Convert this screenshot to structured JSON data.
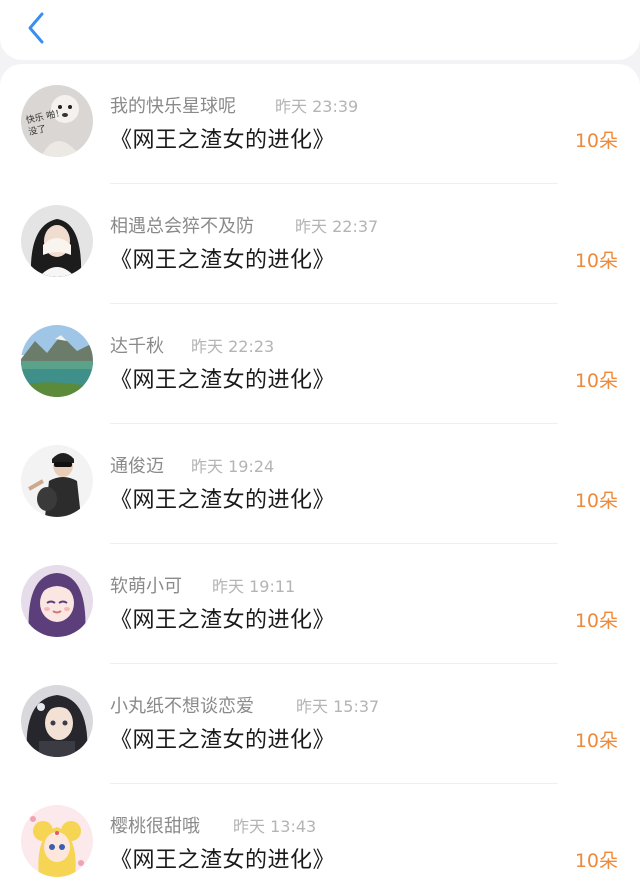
{
  "header": {
    "back_icon": "chevron-left-icon",
    "accent": "#3a8ff0"
  },
  "colors": {
    "amount": "#ee8a3a",
    "name": "#8a8a8a",
    "time": "#b4b4b4"
  },
  "gifts": [
    {
      "user": "我的快乐星球呢",
      "time": "昨天 23:39",
      "title": "《网王之渣女的进化》",
      "amount": "10朵",
      "avatar_caption": "快乐 啪！没了"
    },
    {
      "user": "相遇总会猝不及防",
      "time": "昨天 22:37",
      "title": "《网王之渣女的进化》",
      "amount": "10朵"
    },
    {
      "user": "达千秋",
      "time": "昨天 22:23",
      "title": "《网王之渣女的进化》",
      "amount": "10朵"
    },
    {
      "user": "通俊迈",
      "time": "昨天 19:24",
      "title": "《网王之渣女的进化》",
      "amount": "10朵"
    },
    {
      "user": "软萌小可",
      "time": "昨天 19:11",
      "title": "《网王之渣女的进化》",
      "amount": "10朵"
    },
    {
      "user": "小丸纸不想谈恋爱",
      "time": "昨天 15:37",
      "title": "《网王之渣女的进化》",
      "amount": "10朵"
    },
    {
      "user": "樱桃很甜哦",
      "time": "昨天 13:43",
      "title": "《网王之渣女的进化》",
      "amount": "10朵"
    }
  ]
}
